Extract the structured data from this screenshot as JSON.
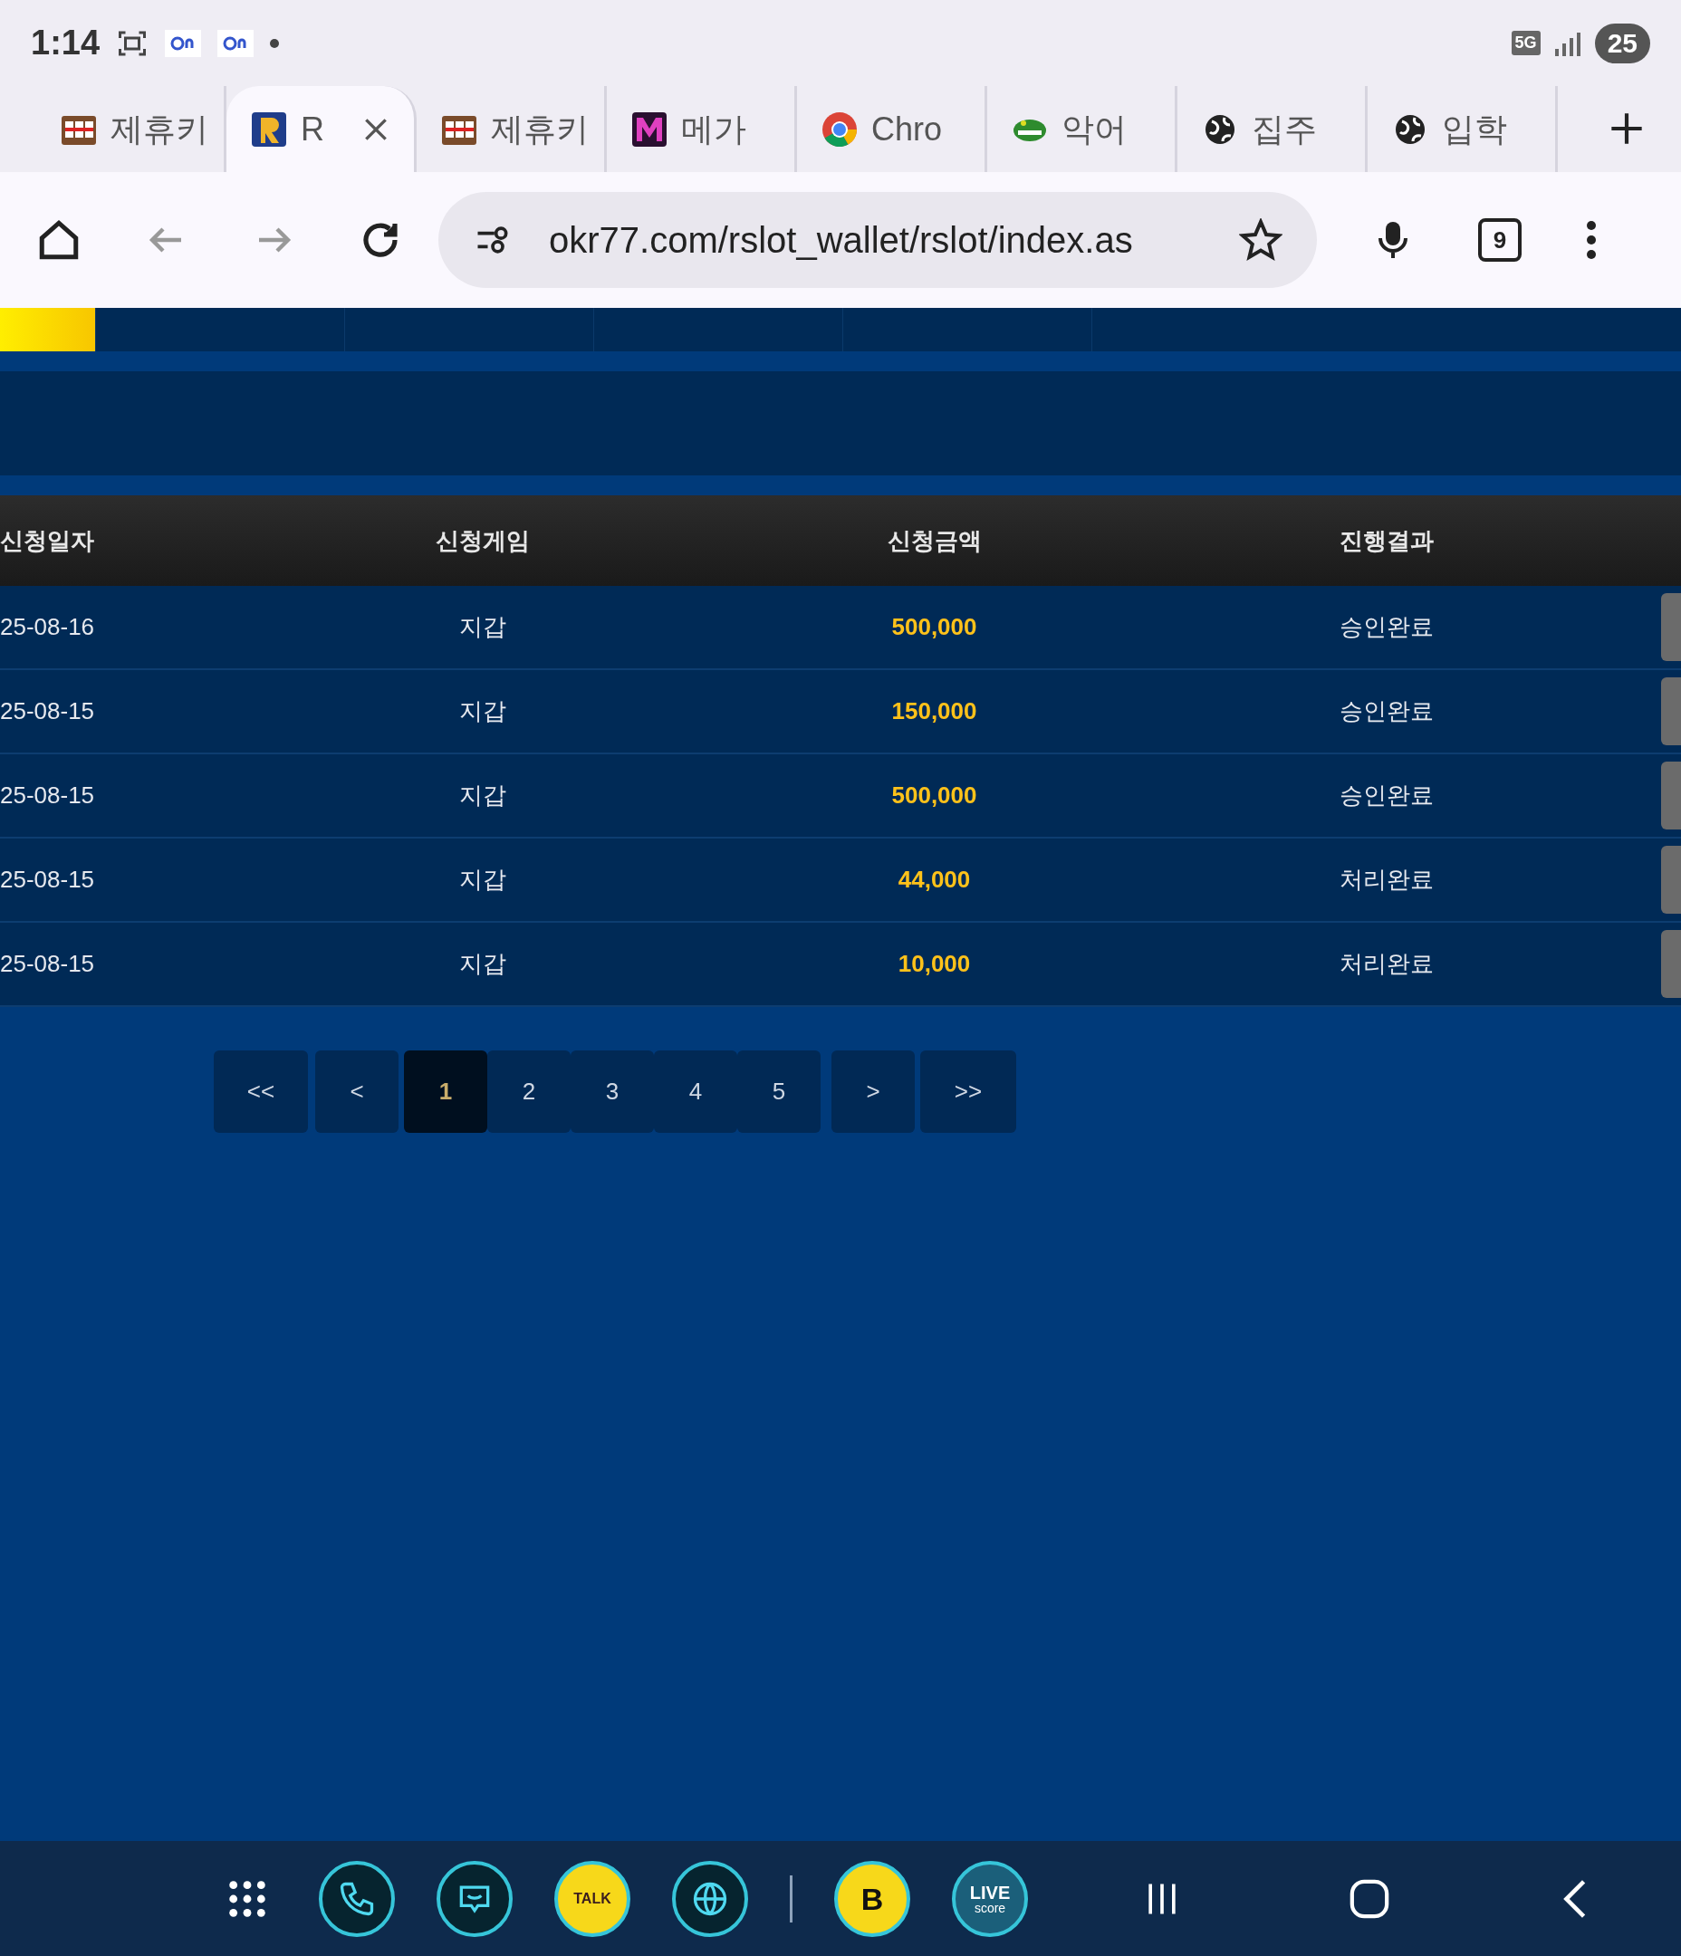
{
  "status_bar": {
    "time": "1:14",
    "network": "5G",
    "battery": "25"
  },
  "browser_tabs": [
    {
      "title": "제휴키",
      "kind": "slot",
      "selected": false
    },
    {
      "title": "R",
      "kind": "rlogo",
      "selected": true
    },
    {
      "title": "제휴키",
      "kind": "slot",
      "selected": false
    },
    {
      "title": "메가",
      "kind": "mlogo",
      "selected": false
    },
    {
      "title": "Chro",
      "kind": "chrome",
      "selected": false
    },
    {
      "title": "악어",
      "kind": "croc",
      "selected": false
    },
    {
      "title": "집주",
      "kind": "globe",
      "selected": false
    },
    {
      "title": "입학",
      "kind": "globe",
      "selected": false
    }
  ],
  "address_bar": {
    "url": "okr77.com/rslot_wallet/rslot/index.as",
    "tab_count": "9"
  },
  "nav_tabs": [
    {
      "selected": true
    },
    {
      "selected": false
    },
    {
      "selected": false
    },
    {
      "selected": false
    },
    {
      "selected": false
    }
  ],
  "table": {
    "columns": [
      "신청일자",
      "신청게임",
      "신청금액",
      "진행결과"
    ],
    "rows": [
      [
        "25-08-16",
        "지갑",
        "500,000",
        "승인완료"
      ],
      [
        "25-08-15",
        "지갑",
        "150,000",
        "승인완료"
      ],
      [
        "25-08-15",
        "지갑",
        "500,000",
        "승인완료"
      ],
      [
        "25-08-15",
        "지갑",
        "44,000",
        "처리완료"
      ],
      [
        "25-08-15",
        "지갑",
        "10,000",
        "처리완료"
      ]
    ]
  },
  "pagination": {
    "first": "<<",
    "prev": "<",
    "pages": [
      {
        "label": "1",
        "selected": true
      },
      {
        "label": "2",
        "selected": false
      },
      {
        "label": "3",
        "selected": false
      },
      {
        "label": "4",
        "selected": false
      },
      {
        "label": "5",
        "selected": false
      }
    ],
    "next": ">",
    "last": ">>"
  },
  "dock": [
    {
      "kind": "phone"
    },
    {
      "kind": "chat"
    },
    {
      "kind": "talk",
      "label": "TALK"
    },
    {
      "kind": "globe"
    },
    {
      "kind": "divider"
    },
    {
      "kind": "letter",
      "label": "B"
    },
    {
      "kind": "live",
      "label": "LIVE",
      "sublabel": "score"
    }
  ]
}
